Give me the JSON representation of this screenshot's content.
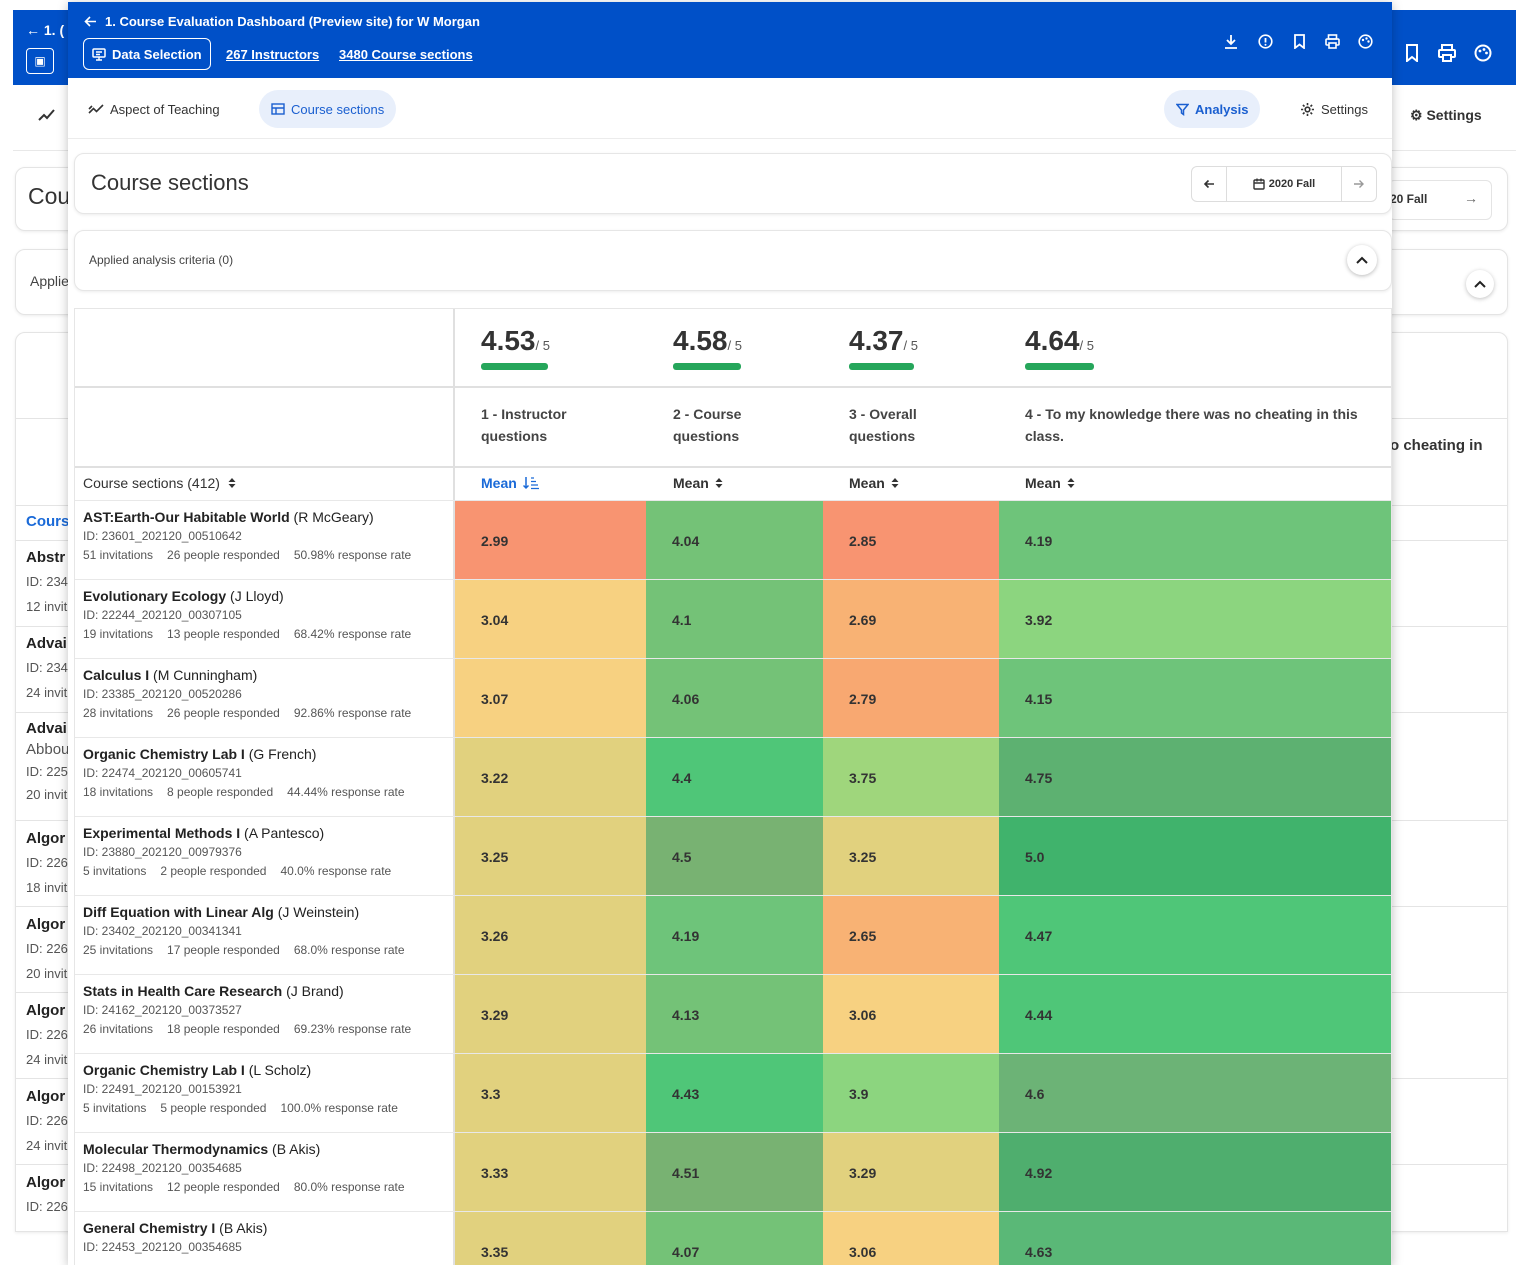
{
  "header": {
    "title": "1. Course Evaluation Dashboard (Preview site) for W Morgan",
    "data_selection": "Data Selection",
    "instructors_link": "267 Instructors",
    "sections_link": "3480 Course sections"
  },
  "background": {
    "back_title": "1. (",
    "title_fragment": "Cou",
    "term_fragment": "20 Fall",
    "applied_fragment": "Applie",
    "question_fragment": "o cheating in",
    "column_fragment": "Cours",
    "settings": "Settings",
    "rows": [
      {
        "t": "Abstr",
        "l1": "ID: 234",
        "l2": "12 invit"
      },
      {
        "t": "Advai",
        "l1": "ID: 234",
        "l2": "24 invit"
      },
      {
        "t": "Advai",
        "l1": "Abbou",
        "l2": "ID: 225",
        "l3": "20 invit"
      },
      {
        "t": "Algor",
        "l1": "ID: 226",
        "l2": "18 invit"
      },
      {
        "t": "Algor",
        "l1": "ID: 226",
        "l2": "20 invit"
      },
      {
        "t": "Algor",
        "l1": "ID: 226",
        "l2": "24 invit"
      },
      {
        "t": "Algor",
        "l1": "ID: 226",
        "l2": "24 invit"
      },
      {
        "t": "Algor",
        "l1": "ID: 226",
        "l2": ""
      }
    ]
  },
  "tabs": {
    "aspect": "Aspect of Teaching",
    "sections": "Course sections",
    "analysis": "Analysis",
    "settings": "Settings"
  },
  "page": {
    "title": "Course sections",
    "term": "2020 Fall",
    "applied_criteria": "Applied analysis criteria (0)"
  },
  "table": {
    "sections_header": "Course sections (412)",
    "columns": [
      {
        "score": "4.53",
        "denom": "/ 5",
        "fill": 0.906,
        "q1": "1 - Instructor",
        "q2": "questions",
        "mean": "Mean"
      },
      {
        "score": "4.58",
        "denom": "/ 5",
        "fill": 0.916,
        "q1": "2 - Course",
        "q2": "questions",
        "mean": "Mean"
      },
      {
        "score": "4.37",
        "denom": "/ 5",
        "fill": 0.874,
        "q1": "3 - Overall",
        "q2": "questions",
        "mean": "Mean"
      },
      {
        "score": "4.64",
        "denom": "/ 5",
        "fill": 0.928,
        "q1": "4 - To my knowledge there was no cheating in this",
        "q2": "class.",
        "mean": "Mean"
      }
    ],
    "rows": [
      {
        "name": "AST:Earth-Our Habitable World",
        "inst": " (R McGeary)",
        "id": "ID: 23601_202120_00510642",
        "inv": "51 invitations",
        "resp": "26 people responded",
        "rate": "50.98% response rate",
        "v": [
          "2.99",
          "4.04",
          "2.85",
          "4.19"
        ]
      },
      {
        "name": "Evolutionary Ecology",
        "inst": " (J Lloyd)",
        "id": "ID: 22244_202120_00307105",
        "inv": "19 invitations",
        "resp": "13 people responded",
        "rate": "68.42% response rate",
        "v": [
          "3.04",
          "4.1",
          "2.69",
          "3.92"
        ]
      },
      {
        "name": "Calculus I",
        "inst": " (M Cunningham)",
        "id": "ID: 23385_202120_00520286",
        "inv": "28 invitations",
        "resp": "26 people responded",
        "rate": "92.86% response rate",
        "v": [
          "3.07",
          "4.06",
          "2.79",
          "4.15"
        ]
      },
      {
        "name": "Organic Chemistry Lab I",
        "inst": " (G French)",
        "id": "ID: 22474_202120_00605741",
        "inv": "18 invitations",
        "resp": "8 people responded",
        "rate": "44.44% response rate",
        "v": [
          "3.22",
          "4.4",
          "3.75",
          "4.75"
        ]
      },
      {
        "name": "Experimental Methods I",
        "inst": " (A Pantesco)",
        "id": "ID: 23880_202120_00979376",
        "inv": "5 invitations",
        "resp": "2 people responded",
        "rate": "40.0% response rate",
        "v": [
          "3.25",
          "4.5",
          "3.25",
          "5.0"
        ]
      },
      {
        "name": "Diff Equation with Linear Alg",
        "inst": " (J Weinstein)",
        "id": "ID: 23402_202120_00341341",
        "inv": "25 invitations",
        "resp": "17 people responded",
        "rate": "68.0% response rate",
        "v": [
          "3.26",
          "4.19",
          "2.65",
          "4.47"
        ]
      },
      {
        "name": "Stats in Health Care Research",
        "inst": " (J Brand)",
        "id": "ID: 24162_202120_00373527",
        "inv": "26 invitations",
        "resp": "18 people responded",
        "rate": "69.23% response rate",
        "v": [
          "3.29",
          "4.13",
          "3.06",
          "4.44"
        ]
      },
      {
        "name": "Organic Chemistry Lab I",
        "inst": " (L Scholz)",
        "id": "ID: 22491_202120_00153921",
        "inv": "5 invitations",
        "resp": "5 people responded",
        "rate": "100.0% response rate",
        "v": [
          "3.3",
          "4.43",
          "3.9",
          "4.6"
        ]
      },
      {
        "name": "Molecular Thermodynamics",
        "inst": " (B Akis)",
        "id": "ID: 22498_202120_00354685",
        "inv": "15 invitations",
        "resp": "12 people responded",
        "rate": "80.0% response rate",
        "v": [
          "3.33",
          "4.51",
          "3.29",
          "4.92"
        ]
      },
      {
        "name": "General Chemistry I",
        "inst": " (B Akis)",
        "id": "ID: 22453_202120_00354685",
        "inv": "",
        "resp": "",
        "rate": "",
        "v": [
          "3.35",
          "4.07",
          "3.06",
          "4.63"
        ]
      }
    ]
  },
  "colors": {
    "brand_blue": "#0050c8",
    "accent_blue": "#1a6ad8",
    "cells": [
      [
        "#f89471",
        "#74c277",
        "#f89471",
        "#6ec47a"
      ],
      [
        "#f7d181",
        "#74c277",
        "#f8b274",
        "#8cd57f"
      ],
      [
        "#f7d181",
        "#74c277",
        "#f8a871",
        "#6ec47a"
      ],
      [
        "#e1d17e",
        "#4fc678",
        "#9fd67c",
        "#5db171"
      ],
      [
        "#e1d17e",
        "#78b272",
        "#e1d17e",
        "#40b36c"
      ],
      [
        "#e1d17e",
        "#6ec47a",
        "#f8b274",
        "#4fc678"
      ],
      [
        "#e1d17e",
        "#74c277",
        "#f7d181",
        "#4fc678"
      ],
      [
        "#e1d17e",
        "#4fc678",
        "#8cd57f",
        "#6cb376"
      ],
      [
        "#e1d17e",
        "#78b272",
        "#e1d17e",
        "#4fae6e"
      ],
      [
        "#e1d17e",
        "#74c277",
        "#f7d181",
        "#5ab877"
      ]
    ]
  }
}
